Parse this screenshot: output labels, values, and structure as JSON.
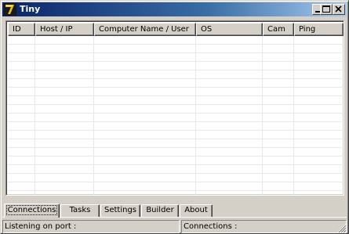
{
  "window": {
    "title": "Tiny",
    "icon": "tiny-app-icon",
    "controls": {
      "minimize": "minimize-icon",
      "maximize": "maximize-icon",
      "close": "close-icon"
    }
  },
  "listview": {
    "columns": [
      "ID",
      "Host / IP",
      "Computer Name / User",
      "OS",
      "Cam",
      "Ping"
    ],
    "rows": []
  },
  "tabs": [
    {
      "label": "Connections",
      "active": true
    },
    {
      "label": "Tasks",
      "active": false
    },
    {
      "label": "Settings",
      "active": false
    },
    {
      "label": "Builder",
      "active": false
    },
    {
      "label": "About",
      "active": false
    }
  ],
  "statusbar": {
    "listening": "Listening on port :",
    "connections": "Connections :"
  },
  "colors": {
    "titlebar_start": "#0a246a",
    "titlebar_end": "#a6caf0",
    "face": "#d4d0c8"
  }
}
